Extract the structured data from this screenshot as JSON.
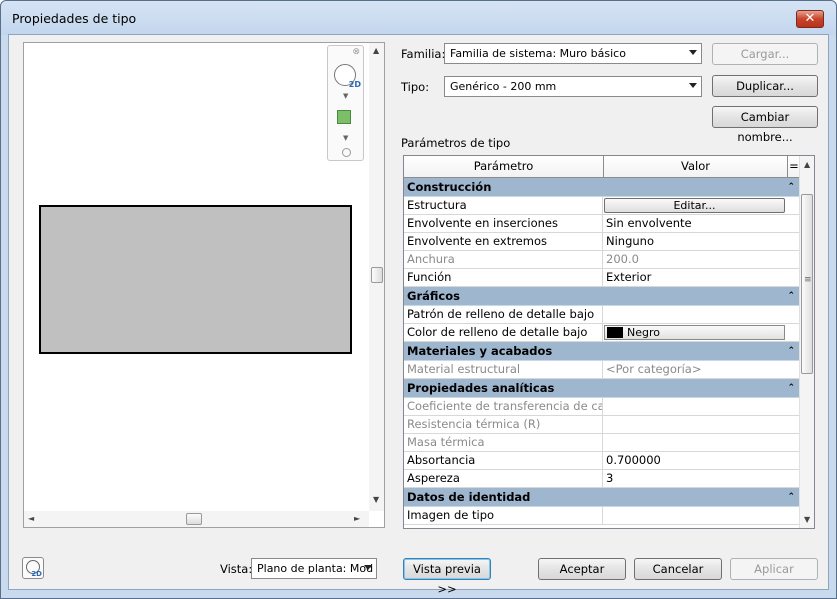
{
  "window": {
    "title": "Propiedades de tipo",
    "close_glyph": "✕"
  },
  "preview": {
    "scroll_up": "▲",
    "scroll_down": "▼",
    "scroll_left": "◄",
    "scroll_right": "►",
    "nav_close": "⊗",
    "nav_2d": "2D",
    "nav_down": "▼"
  },
  "fields": {
    "familia_label": "Familia:",
    "familia_value": "Familia de sistema: Muro básico",
    "tipo_label": "Tipo:",
    "tipo_value": "Genérico - 200 mm"
  },
  "buttons": {
    "cargar": "Cargar...",
    "duplicar": "Duplicar...",
    "cambiar_nombre": "Cambiar nombre...",
    "vista_previa": "Vista previa >>",
    "aceptar": "Aceptar",
    "cancelar": "Cancelar",
    "aplicar": "Aplicar"
  },
  "params": {
    "section_label": "Parámetros de tipo",
    "col_param": "Parámetro",
    "col_valor": "Valor",
    "col_eq": "=",
    "groups": [
      {
        "title": "Construcción",
        "rows": [
          {
            "name": "Estructura",
            "value": "Editar...",
            "kind": "button"
          },
          {
            "name": "Envolvente en inserciones",
            "value": "Sin envolvente"
          },
          {
            "name": "Envolvente en extremos",
            "value": "Ninguno"
          },
          {
            "name": "Anchura",
            "value": "200.0",
            "grey": true
          },
          {
            "name": "Función",
            "value": "Exterior"
          }
        ]
      },
      {
        "title": "Gráficos",
        "rows": [
          {
            "name": "Patrón de relleno de detalle bajo",
            "value": ""
          },
          {
            "name": "Color de relleno de detalle bajo",
            "value": "Negro",
            "kind": "swatch",
            "color": "#000000"
          }
        ]
      },
      {
        "title": "Materiales y acabados",
        "rows": [
          {
            "name": "Material estructural",
            "value": "<Por categoría>",
            "grey": true
          }
        ]
      },
      {
        "title": "Propiedades analíticas",
        "rows": [
          {
            "name": "Coeficiente de transferencia de calor",
            "value": "",
            "grey": true
          },
          {
            "name": "Resistencia térmica (R)",
            "value": "",
            "grey": true
          },
          {
            "name": "Masa térmica",
            "value": "",
            "grey": true
          },
          {
            "name": "Absortancia",
            "value": "0.700000"
          },
          {
            "name": "Aspereza",
            "value": "3"
          }
        ]
      },
      {
        "title": "Datos de identidad",
        "rows": [
          {
            "name": "Imagen de tipo",
            "value": ""
          }
        ]
      }
    ],
    "collapse_glyph": "⌃"
  },
  "bottom": {
    "vista_label": "Vista:",
    "vista_value": "Plano de planta: Mod",
    "icon_2d": "2D"
  },
  "colors": {
    "group_header": "#9fb6cf",
    "window_frame": "#c9daee",
    "close_button": "#c7442b"
  }
}
